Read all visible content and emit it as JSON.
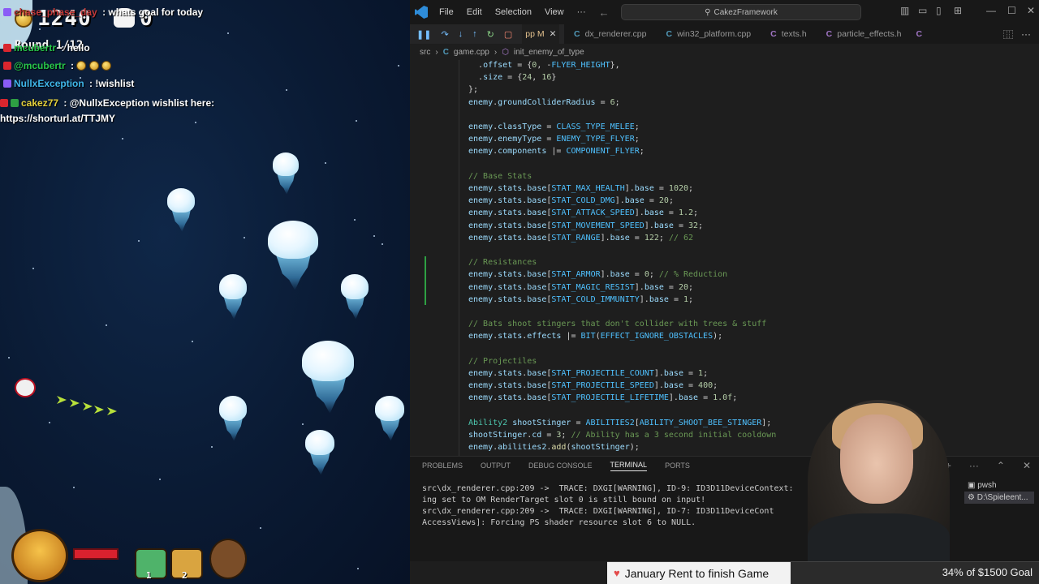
{
  "game": {
    "score": "1240",
    "skull_count": "0",
    "round": "Round 1/12",
    "chat": [
      {
        "user": "chase_phase_day",
        "msg": " : whats goal for today",
        "color": "#c43a3a"
      },
      {
        "user": "mcubertr",
        "msg": " : hello",
        "color": "#27c64a"
      },
      {
        "user": "@mcubertr",
        "msg": " : ",
        "color": "#27c64a"
      },
      {
        "user": "NullxException",
        "msg": " : !wishlist",
        "color": "#3fb6e8"
      },
      {
        "user": "cakez77",
        "msg": " : @NullxException wishlist here: https://shorturl.at/TTJMY",
        "color": "#e6d13a"
      }
    ],
    "abilities": [
      {
        "slot": "1",
        "color": "#4fb36a"
      },
      {
        "slot": "2",
        "color": "#d9a440"
      }
    ]
  },
  "vscode": {
    "menu": [
      "File",
      "Edit",
      "Selection",
      "View"
    ],
    "more": "···",
    "title": "CakezFramework",
    "tabs": [
      {
        "icon": "C",
        "label": "pp M",
        "active": true
      },
      {
        "icon": "C",
        "label": "dx_renderer.cpp"
      },
      {
        "icon": "C",
        "label": "win32_platform.cpp"
      },
      {
        "icon": "C",
        "label": "texts.h"
      },
      {
        "icon": "C",
        "label": "particle_effects.h"
      },
      {
        "icon": "C",
        "label": ""
      }
    ],
    "breadcrumb": [
      "src",
      "game.cpp",
      "init_enemy_of_type"
    ],
    "code": [
      "  .offset = {0, -FLYER_HEIGHT},",
      "  .size = {24, 16}",
      "};",
      "enemy.groundColliderRadius = 6;",
      "",
      "enemy.classType = CLASS_TYPE_MELEE;",
      "enemy.enemyType = ENEMY_TYPE_FLYER;",
      "enemy.components |= COMPONENT_FLYER;",
      "",
      "// Base Stats",
      "enemy.stats.base[STAT_MAX_HEALTH].base = 1020;",
      "enemy.stats.base[STAT_COLD_DMG].base = 20;",
      "enemy.stats.base[STAT_ATTACK_SPEED].base = 1.2;",
      "enemy.stats.base[STAT_MOVEMENT_SPEED].base = 32;",
      "enemy.stats.base[STAT_RANGE].base = 122; // 62",
      "",
      "// Resistances",
      "enemy.stats.base[STAT_ARMOR].base = 0; // % Reduction",
      "enemy.stats.base[STAT_MAGIC_RESIST].base = 20;",
      "enemy.stats.base[STAT_COLD_IMMUNITY].base = 1;",
      "",
      "// Bats shoot stingers that don't collider with trees & stuff",
      "enemy.stats.effects |= BIT(EFFECT_IGNORE_OBSTACLES);",
      "",
      "// Projectiles",
      "enemy.stats.base[STAT_PROJECTILE_COUNT].base = 1;",
      "enemy.stats.base[STAT_PROJECTILE_SPEED].base = 400;",
      "enemy.stats.base[STAT_PROJECTILE_LIFETIME].base = 1.0f;",
      "",
      "Ability2 shootStinger = ABILITIES2[ABILITY_SHOOT_BEE_STINGER];",
      "shootStinger.cd = 3; // Ability has a 3 second initial cooldown",
      "enemy.abilities2.add(shootStinger);"
    ],
    "panel_tabs": [
      "PROBLEMS",
      "OUTPUT",
      "DEBUG CONSOLE",
      "TERMINAL",
      "PORTS"
    ],
    "terminal": [
      "src\\dx_renderer.cpp:209 ->  TRACE: DXGI[WARNING], ID-9: ID3D11DeviceContext:",
      "ing set to OM RenderTarget slot 0 is still bound on input!",
      "src\\dx_renderer.cpp:209 ->  TRACE: DXGI[WARNING], ID-7: ID3D11DeviceCont",
      "AccessViews]: Forcing PS shader resource slot 6 to NULL."
    ],
    "terminal_sessions": [
      "pwsh",
      "D:\\Spieleent..."
    ]
  },
  "goal": {
    "left": "January Rent to finish Game",
    "right": "34% of $1500 Goal"
  }
}
